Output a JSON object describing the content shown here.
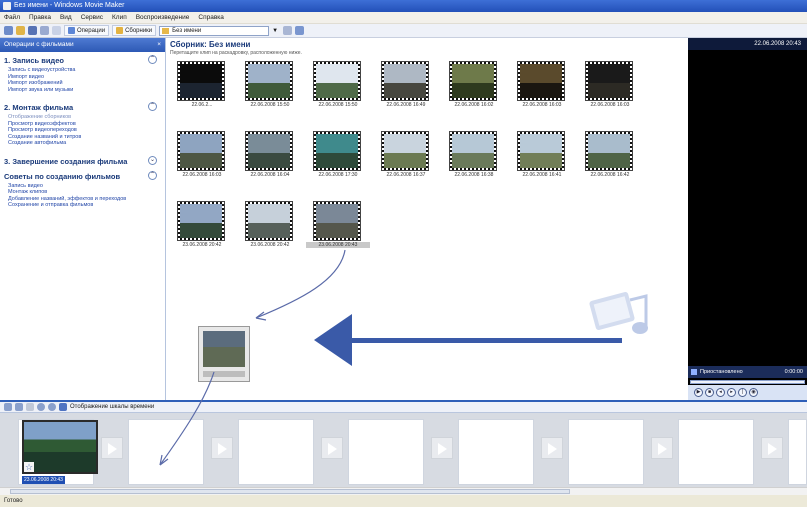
{
  "window": {
    "title": "Без имени - Windows Movie Maker"
  },
  "menu": [
    "Файл",
    "Правка",
    "Вид",
    "Сервис",
    "Клип",
    "Воспроизведение",
    "Справка"
  ],
  "toolbar": {
    "tasks_label": "Операции",
    "collections_label": "Сборники",
    "collection_combo_value": "Без имени"
  },
  "tasks_pane": {
    "header": "Операции с фильмами",
    "sections": [
      {
        "title": "1. Запись видео",
        "items": [
          "Запись с видеоустройства",
          "Импорт видео",
          "Импорт изображений",
          "Импорт звука или музыки"
        ]
      },
      {
        "title": "2. Монтаж фильма",
        "items": [
          "Отображение сборников",
          "Просмотр видеоэффектов",
          "Просмотр видеопереходов",
          "Создание названий и титров",
          "Создание автофильма"
        ]
      },
      {
        "title": "3. Завершение создания фильма",
        "items": []
      },
      {
        "title": "Советы по созданию фильмов",
        "items": [
          "Запись видео",
          "Монтаж клипов",
          "Добавление названий, эффектов и переходов",
          "Сохранение и отправка фильмов"
        ]
      }
    ]
  },
  "collection": {
    "title": "Сборник: Без имени",
    "subtitle": "Перетащите клип на раскадровку, расположенную ниже.",
    "clips": [
      {
        "caption": "22.06.2..."
      },
      {
        "caption": "22.06.2008 15:50"
      },
      {
        "caption": "22.06.2008 15:50"
      },
      {
        "caption": "22.06.2008 16:49"
      },
      {
        "caption": "22.06.2008 16:02"
      },
      {
        "caption": "22.06.2008 16:03"
      },
      {
        "caption": "22.06.2008 16:03"
      },
      {
        "caption": "22.06.2008 16:03"
      },
      {
        "caption": "22.06.2008 16:04"
      },
      {
        "caption": "22.06.2008 17:30"
      },
      {
        "caption": "22.06.2008 16:37"
      },
      {
        "caption": "22.06.2008 16:38"
      },
      {
        "caption": "22.06.2008 16:41"
      },
      {
        "caption": "22.06.2008 16:42"
      },
      {
        "caption": "23.06.2008 20:42"
      },
      {
        "caption": "23.06.2008 20:42"
      },
      {
        "caption": "23.06.2008 20:43"
      }
    ]
  },
  "preview": {
    "datetime": "22.06.2008 20:43",
    "status": "Приостановлено",
    "time": "0:00:00"
  },
  "storyboard": {
    "toggle_label": "Отображение шкалы времени",
    "first_clip_caption": "23.06.2008 20:43"
  },
  "statusbar": {
    "text": "Готово"
  },
  "colors": {
    "accent": "#2f5fb8",
    "arrow": "#3a5aa8"
  }
}
